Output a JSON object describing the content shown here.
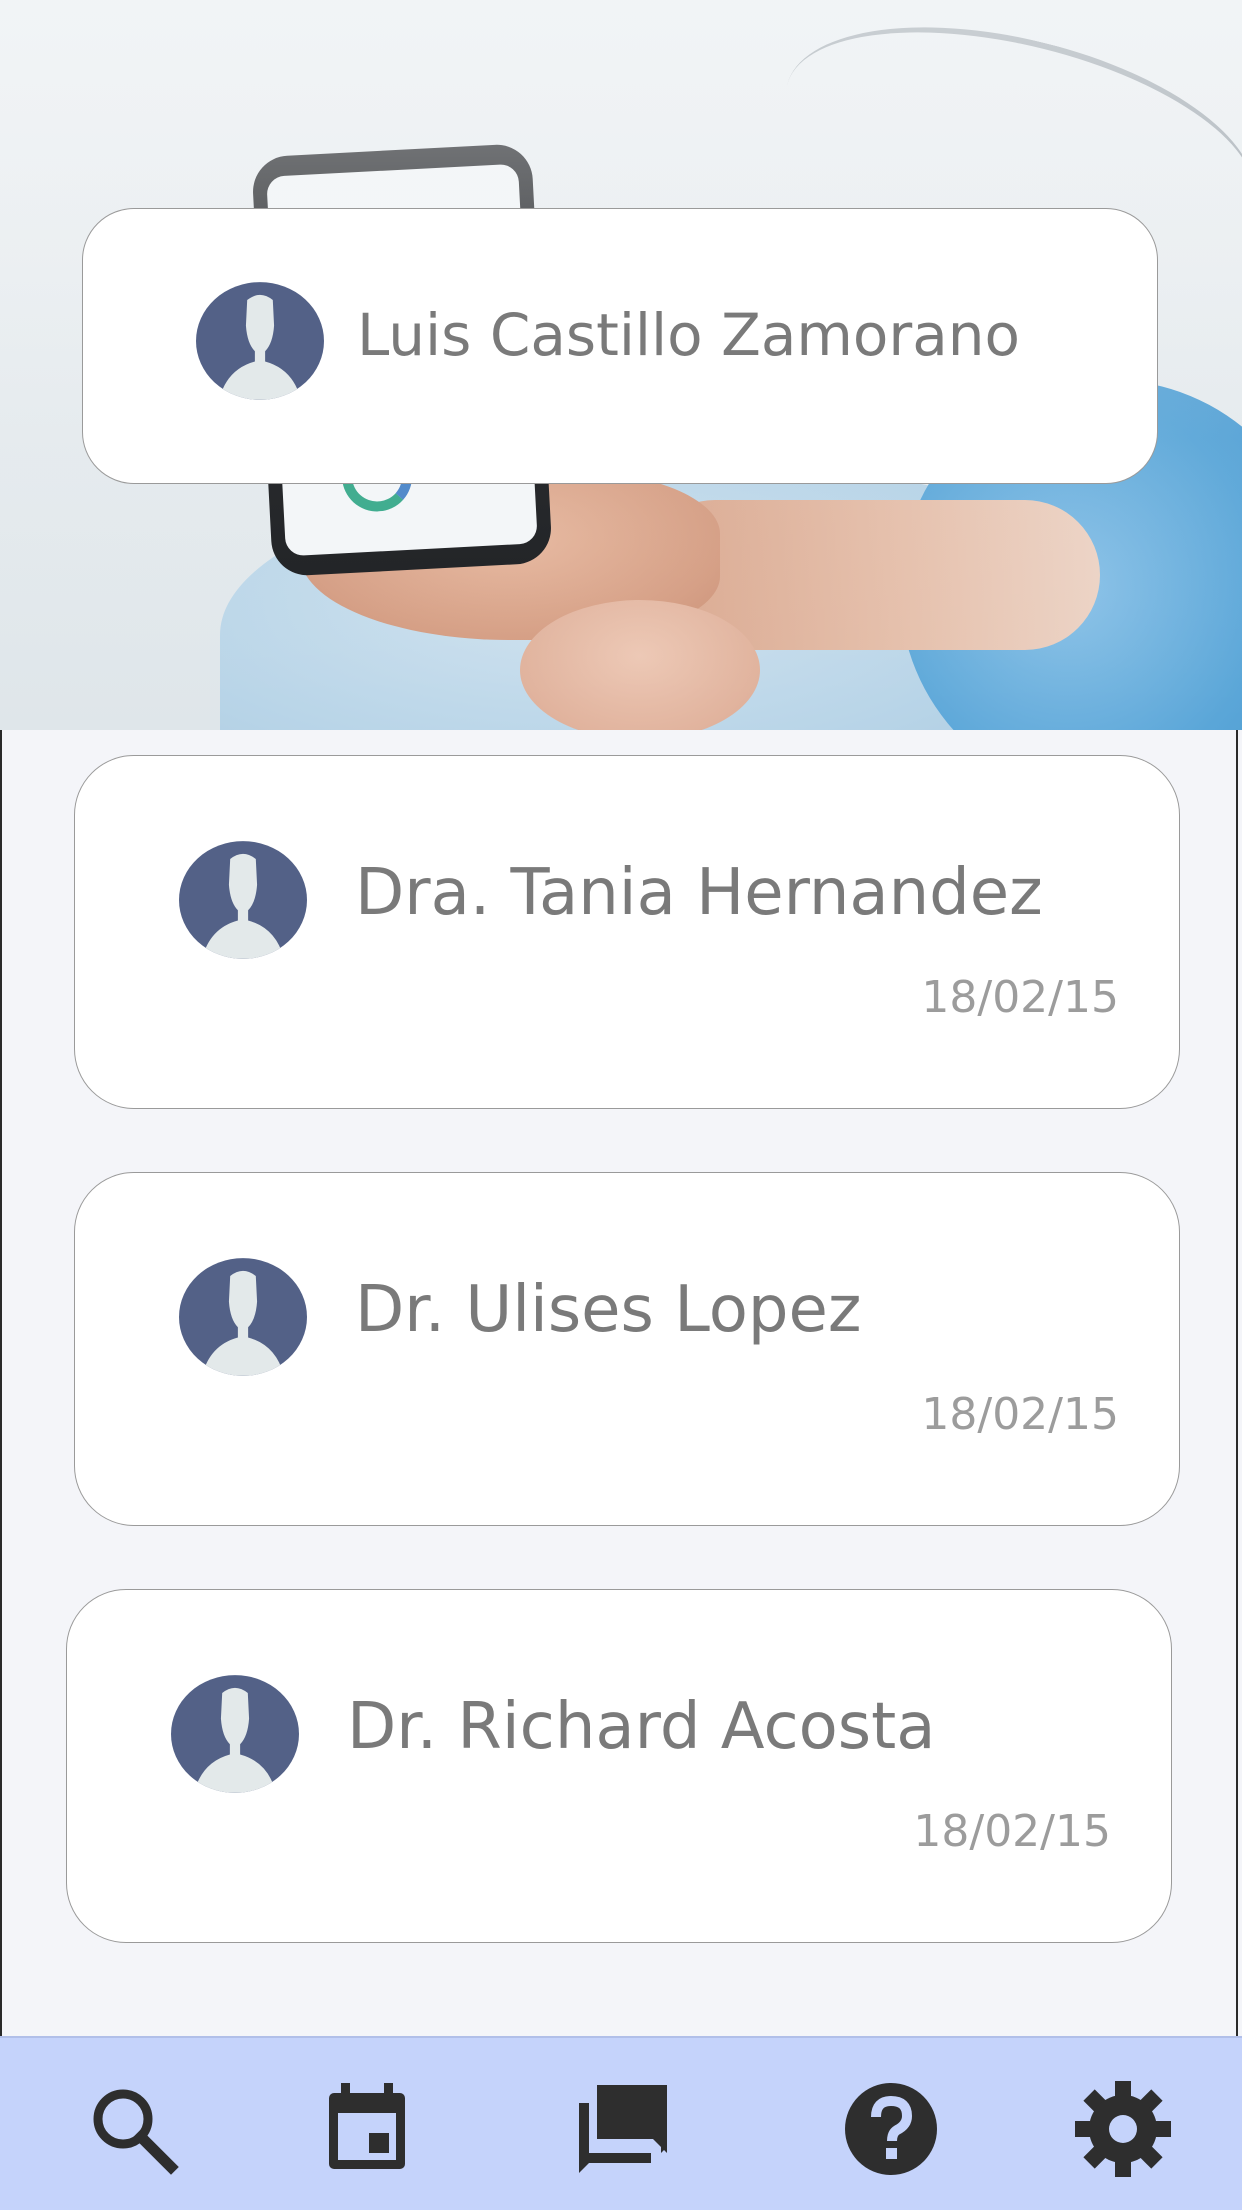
{
  "profile": {
    "name": "Luis Castillo Zamorano"
  },
  "doctors": [
    {
      "name": "Dra. Tania Hernandez",
      "date": "18/02/15"
    },
    {
      "name": "Dr. Ulises Lopez",
      "date": "18/02/15"
    },
    {
      "name": "Dr. Richard Acosta",
      "date": "18/02/15"
    }
  ],
  "bottom_nav": {
    "items": [
      {
        "icon": "search-icon"
      },
      {
        "icon": "calendar-icon"
      },
      {
        "icon": "chat-icon"
      },
      {
        "icon": "help-icon"
      },
      {
        "icon": "gear-icon"
      }
    ]
  },
  "colors": {
    "avatar_fill": "#536187",
    "avatar_silhouette": "#e3e9ea",
    "name_text": "#7a7a7a",
    "date_text": "#9c9c9c",
    "nav_background": "#c5d3fb",
    "nav_icon": "#2e2e2e",
    "page_background": "#f4f5f9"
  }
}
